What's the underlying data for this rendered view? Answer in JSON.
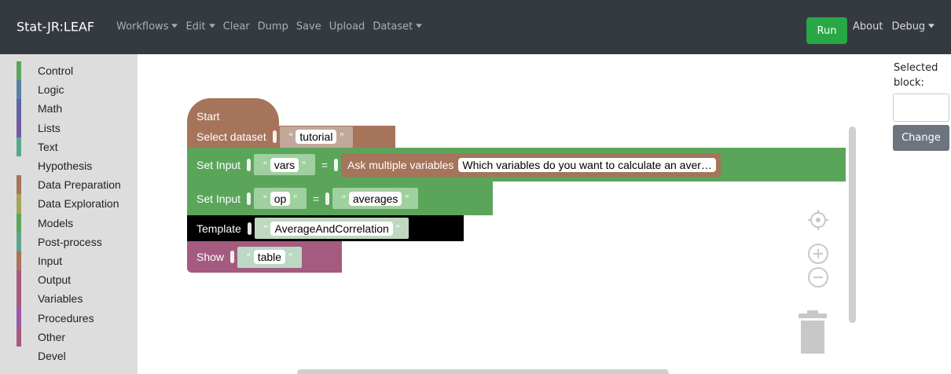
{
  "navbar": {
    "brand": "Stat-JR:LEAF",
    "items": [
      {
        "label": "Workflows",
        "dropdown": true
      },
      {
        "label": "Edit",
        "dropdown": true
      },
      {
        "label": "Clear",
        "dropdown": false
      },
      {
        "label": "Dump",
        "dropdown": false
      },
      {
        "label": "Save",
        "dropdown": false
      },
      {
        "label": "Upload",
        "dropdown": false
      },
      {
        "label": "Dataset",
        "dropdown": true
      }
    ],
    "run_label": "Run",
    "about_label": "About",
    "debug_label": "Debug"
  },
  "toolbox": {
    "categories": [
      {
        "label": "Control",
        "color": "#5ba55b"
      },
      {
        "label": "Logic",
        "color": "#5b80a5"
      },
      {
        "label": "Math",
        "color": "#5b67a5"
      },
      {
        "label": "Lists",
        "color": "#745ba5"
      },
      {
        "label": "Text",
        "color": "#5ba58c"
      },
      {
        "label": "Hypothesis",
        "color": ""
      },
      {
        "label": "Data Preparation",
        "color": "#a5745b"
      },
      {
        "label": "Data Exploration",
        "color": "#a5a55b"
      },
      {
        "label": "Models",
        "color": "#5ba55b"
      },
      {
        "label": "Post-process",
        "color": "#5ba58c"
      },
      {
        "label": "Input",
        "color": "#a5745b"
      },
      {
        "label": "Output",
        "color": "#a55b80"
      },
      {
        "label": "Variables",
        "color": "#a55b80"
      },
      {
        "label": "Procedures",
        "color": "#995ba5"
      },
      {
        "label": "Other",
        "color": "#a55b80"
      },
      {
        "label": "Devel",
        "color": ""
      }
    ]
  },
  "blocks": {
    "start": {
      "label": "Start"
    },
    "select_dataset": {
      "label": "Select dataset",
      "value": "tutorial"
    },
    "set_input_1": {
      "label": "Set Input",
      "name": "vars",
      "eq": "=",
      "ask_label": "Ask multiple variables",
      "ask_value": "Which variables do you want to calculate an aver…"
    },
    "set_input_2": {
      "label": "Set Input",
      "name": "op",
      "eq": "=",
      "value": "averages"
    },
    "template": {
      "label": "Template",
      "value": "AverageAndCorrelation"
    },
    "show": {
      "label": "Show",
      "value": "table"
    },
    "quote_open": "“",
    "quote_close": "”"
  },
  "right_panel": {
    "selected_label": "Selected block:",
    "selected_value": "",
    "change_label": "Change"
  },
  "icons": {
    "center": "crosshair-icon",
    "zoom_in": "zoom-in-icon",
    "zoom_out": "zoom-out-icon",
    "trash": "trash-icon"
  }
}
